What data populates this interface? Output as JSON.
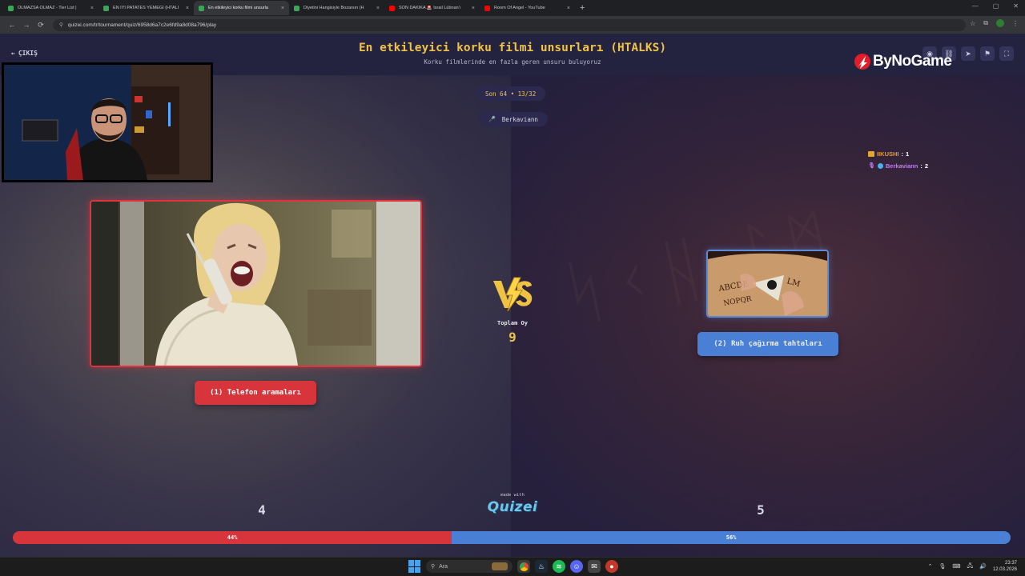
{
  "browser": {
    "tabs": [
      {
        "label": "OLMAZSA OLMAZ - Tier List | ",
        "color": "#3aa757",
        "active": false
      },
      {
        "label": "EN İYİ PATATES YEMEĞİ (HTALI",
        "color": "#3aa757",
        "active": false
      },
      {
        "label": "En etkileyici korku filmi unsurla",
        "color": "#3aa757",
        "active": true
      },
      {
        "label": "Diyetini Hangisiyle Bozarsın (H",
        "color": "#3aa757",
        "active": false
      },
      {
        "label": "SON DAKİKA 🚨 İsrail Lübnan'ı",
        "color": "#ff0000",
        "active": false
      },
      {
        "label": "Room Of Angel - YouTube",
        "color": "#ff0000",
        "active": false
      }
    ],
    "url": "quizei.com/tr/tournament/quiz/6958d6a7c2e6fd9a8d08a796/play",
    "new_tab_icon": "+",
    "close_icon": "×"
  },
  "header": {
    "exit_label": "ÇIKIŞ",
    "title": "En etkileyici korku filmi unsurları (HTALKS)",
    "subtitle": "Korku filmlerinde en fazla geren unsuru buluyoruz",
    "icons": [
      "eye-icon",
      "link-icon",
      "share-icon",
      "flag-icon",
      "fullscreen-icon"
    ]
  },
  "round": {
    "label": "Son 64 • 13/32",
    "user_icon": "🎤",
    "user": "Berkaviann"
  },
  "leaderboard": [
    {
      "name": "IIKUSHI",
      "score": "1",
      "color": "#e69a2e"
    },
    {
      "name": "Berkaviann",
      "score": "2",
      "color": "#c07cf0"
    }
  ],
  "left_option": {
    "label": "(1) Telefon aramaları",
    "votes": "4",
    "percent_label": "44%",
    "percent": 44,
    "color": "#d8343c"
  },
  "right_option": {
    "label": "(2) Ruh çağırma tahtaları",
    "votes": "5",
    "percent_label": "56%",
    "percent": 56,
    "color": "#4a7fd6"
  },
  "center": {
    "total_label": "Toplam Oy",
    "total_value": "9",
    "made_with": "made with",
    "brand": "Quizei"
  },
  "overlay": {
    "brand": "ByNoGame"
  },
  "taskbar": {
    "search_label": "Ara",
    "time": "23:37",
    "date": "12.03.2026"
  }
}
